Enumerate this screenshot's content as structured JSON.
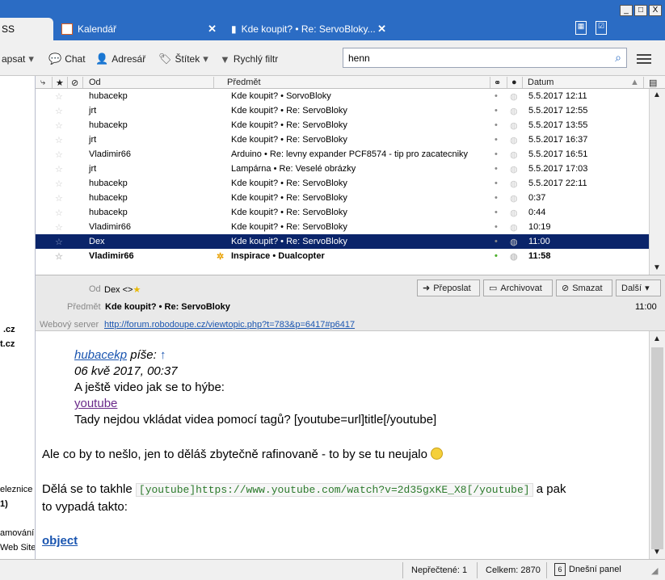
{
  "tabs": [
    {
      "label": "SS"
    },
    {
      "label": "Kalendář"
    },
    {
      "label": "Kde koupit? • Re: ServoBloky..."
    }
  ],
  "window_controls": [
    "_",
    "□",
    "X"
  ],
  "toolbar": {
    "write": "apsat",
    "chat": "Chat",
    "address_book": "Adresář",
    "tag": "Štítek",
    "quick_filter": "Rychlý filtr",
    "search_value": "henn"
  },
  "sidebar": {
    "items": [
      ".cz",
      "t.cz",
      "eleznice",
      "1)",
      "amování",
      "Web Site"
    ]
  },
  "columns": {
    "from": "Od",
    "subject": "Předmět",
    "date": "Datum"
  },
  "messages": [
    {
      "from": "hubacekp",
      "subject": "Kde koupit? • SorvoBloky",
      "date": "5.5.2017 12:11"
    },
    {
      "from": "jrt",
      "subject": "Kde koupit? • Re: ServoBloky",
      "date": "5.5.2017 12:55"
    },
    {
      "from": "hubacekp",
      "subject": "Kde koupit? • Re: ServoBloky",
      "date": "5.5.2017 13:55"
    },
    {
      "from": "jrt",
      "subject": "Kde koupit? • Re: ServoBloky",
      "date": "5.5.2017 16:37"
    },
    {
      "from": "Vladimir66",
      "subject": "Arduino • Re: levny expander PCF8574 - tip pro zacatecniky",
      "date": "5.5.2017 16:51"
    },
    {
      "from": "jrt",
      "subject": "Lampárna • Re: Veselé obrázky",
      "date": "5.5.2017 17:03"
    },
    {
      "from": "hubacekp",
      "subject": "Kde koupit? • Re: ServoBloky",
      "date": "5.5.2017 22:11"
    },
    {
      "from": "hubacekp",
      "subject": "Kde koupit? • Re: ServoBloky",
      "date": "0:37"
    },
    {
      "from": "hubacekp",
      "subject": "Kde koupit? • Re: ServoBloky",
      "date": "0:44"
    },
    {
      "from": "Vladimir66",
      "subject": "Kde koupit? • Re: ServoBloky",
      "date": "10:19"
    },
    {
      "from": "Dex",
      "subject": "Kde koupit? • Re: ServoBloky",
      "date": "11:00"
    },
    {
      "from": "Vladimir66",
      "subject": "Inspirace • Dualcopter",
      "date": "11:58"
    }
  ],
  "header": {
    "from_label": "Od",
    "from_value": "Dex <>",
    "subject_label": "Předmět",
    "subject_value": "Kde koupit? • Re: ServoBloky",
    "web_label": "Webový server",
    "web_url": "http://forum.robodoupe.cz/viewtopic.php?t=783&p=6417#p6417",
    "time": "11:00",
    "forward": "Přeposlat",
    "archive": "Archivovat",
    "delete": "Smazat",
    "more": "Další"
  },
  "body": {
    "quote_author": "hubacekp",
    "quote_writes": "píše:",
    "quote_date": "06 kvě 2017, 00:37",
    "quote_line1": "A ještě video jak se to hýbe:",
    "quote_link": "youtube",
    "quote_line2": "Tady nejdou vkládat videa pomocí tagů? [youtube=url]title[/youtube]",
    "para1": "Ale co by to nešlo, jen to děláš zbytečně rafinovaně - to by se tu neujalo",
    "para2_a": "Dělá se to takhle",
    "code": "[youtube]https://www.youtube.com/watch?v=2d35gxKE_X8[/youtube]",
    "para2_b": "a pak",
    "para2_c": "to vypadá takto:",
    "object_link": "object"
  },
  "status": {
    "unread": "Nepřečtené: 1",
    "total": "Celkem: 2870",
    "today_panel": "Dnešní panel",
    "today_day": "6"
  }
}
